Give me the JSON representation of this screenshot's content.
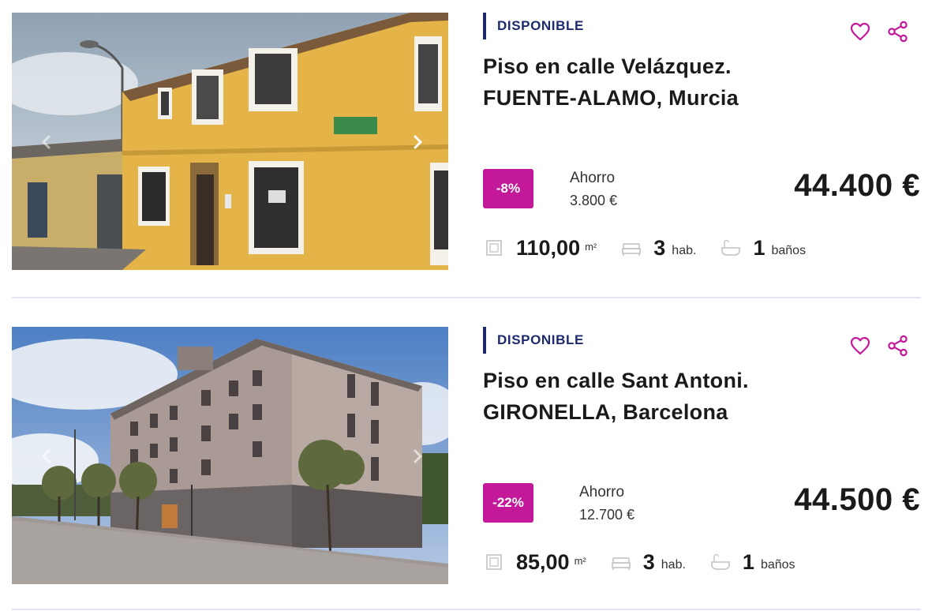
{
  "listings": [
    {
      "status": "DISPONIBLE",
      "title_line1": "Piso en calle Velázquez.",
      "title_line2": "FUENTE-ALAMO, Murcia",
      "discount": "-8%",
      "saving_label": "Ahorro",
      "saving_amount": "3.800 €",
      "price": "44.400 €",
      "area_value": "110,00",
      "area_unit": "m²",
      "rooms_value": "3",
      "rooms_unit": "hab.",
      "baths_value": "1",
      "baths_unit": "baños"
    },
    {
      "status": "DISPONIBLE",
      "title_line1": "Piso en calle Sant Antoni.",
      "title_line2": "GIRONELLA, Barcelona",
      "discount": "-22%",
      "saving_label": "Ahorro",
      "saving_amount": "12.700 €",
      "price": "44.500 €",
      "area_value": "85,00",
      "area_unit": "m²",
      "rooms_value": "3",
      "rooms_unit": "hab.",
      "baths_value": "1",
      "baths_unit": "baños"
    }
  ],
  "icons": {
    "favorite": "heart-icon",
    "share": "share-icon",
    "prev": "chevron-left-icon",
    "next": "chevron-right-icon",
    "area": "floor-plan-icon",
    "rooms": "bed-icon",
    "baths": "bathtub-icon"
  },
  "colors": {
    "accent": "#c4189b",
    "status": "#1d2a6e",
    "divider": "#e4e3f0"
  }
}
